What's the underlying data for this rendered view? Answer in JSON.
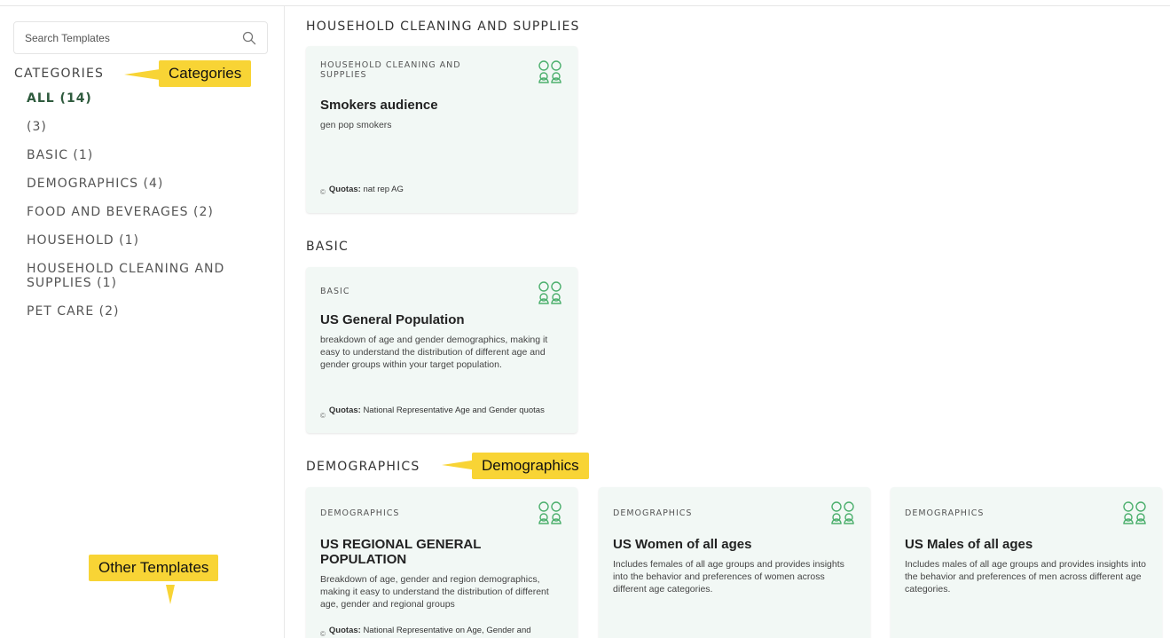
{
  "search": {
    "placeholder": "Search Templates"
  },
  "categories": {
    "title": "CATEGORIES",
    "items": [
      {
        "label": "ALL (14)"
      },
      {
        "label": "(3)"
      },
      {
        "label": "BASIC (1)"
      },
      {
        "label": "DEMOGRAPHICS (4)"
      },
      {
        "label": "FOOD AND BEVERAGES (2)"
      },
      {
        "label": "HOUSEHOLD (1)"
      },
      {
        "label": "HOUSEHOLD CLEANING AND SUPPLIES (1)"
      },
      {
        "label": "PET CARE (2)"
      }
    ]
  },
  "callouts": {
    "categories": "Categories",
    "demographics": "Demographics",
    "other_templates": "Other Templates"
  },
  "sections": [
    {
      "title": "HOUSEHOLD CLEANING AND SUPPLIES",
      "cards": [
        {
          "category": "HOUSEHOLD CLEANING AND SUPPLIES",
          "title": "Smokers audience",
          "description": "gen pop smokers",
          "quota_label": "Quotas:",
          "quota_value": "nat rep AG"
        }
      ]
    },
    {
      "title": "BASIC",
      "cards": [
        {
          "category": "BASIC",
          "title": "US General Population",
          "description": "breakdown of age and gender demographics, making it easy to understand the distribution of different age and gender groups within your target population.",
          "quota_label": "Quotas:",
          "quota_value": "National Representative Age and Gender quotas"
        }
      ]
    },
    {
      "title": "DEMOGRAPHICS",
      "cards": [
        {
          "category": "DEMOGRAPHICS",
          "title": "US REGIONAL GENERAL POPULATION",
          "description": "Breakdown of age, gender and region demographics, making it easy to understand the distribution of different age, gender and regional groups",
          "quota_label": "Quotas:",
          "quota_value": "National Representative on Age, Gender and"
        },
        {
          "category": "DEMOGRAPHICS",
          "title": "US Women of all ages",
          "description": "Includes females of all age groups and provides insights into the behavior and preferences of women across different age categories."
        },
        {
          "category": "DEMOGRAPHICS",
          "title": "US Males of all ages",
          "description": "Includes males of all age groups and provides insights into the behavior and preferences of men across different age categories."
        }
      ]
    }
  ],
  "icon_names": {
    "search": "search-icon",
    "card": "people-group-icon",
    "quota": "copyright-icon"
  },
  "colors": {
    "accent": "#2f5b3e",
    "card_bg": "#f2f8f5",
    "callout": "#f8d435",
    "icon": "#4caf6d"
  }
}
